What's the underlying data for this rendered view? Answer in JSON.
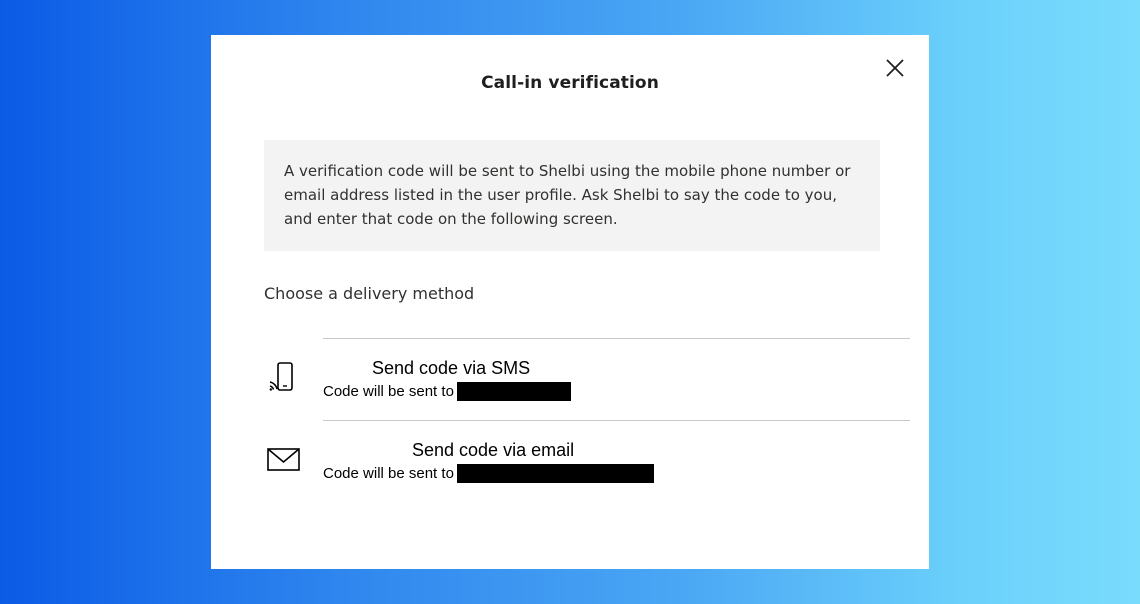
{
  "dialog": {
    "title": "Call-in verification",
    "close_icon": "close-icon",
    "info_text": "A verification code will be sent to Shelbi using the mobile phone number or email address listed in the user profile. Ask Shelbi to say the code to you, and enter that code on the following screen.",
    "section_label": "Choose a delivery method",
    "methods": [
      {
        "icon": "mobile-phone-icon",
        "title": "Send code via SMS",
        "subtitle": "Code will be sent to"
      },
      {
        "icon": "mail-icon",
        "title": "Send code via email",
        "subtitle": "Code will be sent to"
      }
    ]
  },
  "colors": {
    "background_start": "#0b5be6",
    "background_end": "#79dcfd",
    "dialog_bg": "#ffffff",
    "info_bg": "#f3f3f3",
    "divider": "#c8c8c8"
  }
}
